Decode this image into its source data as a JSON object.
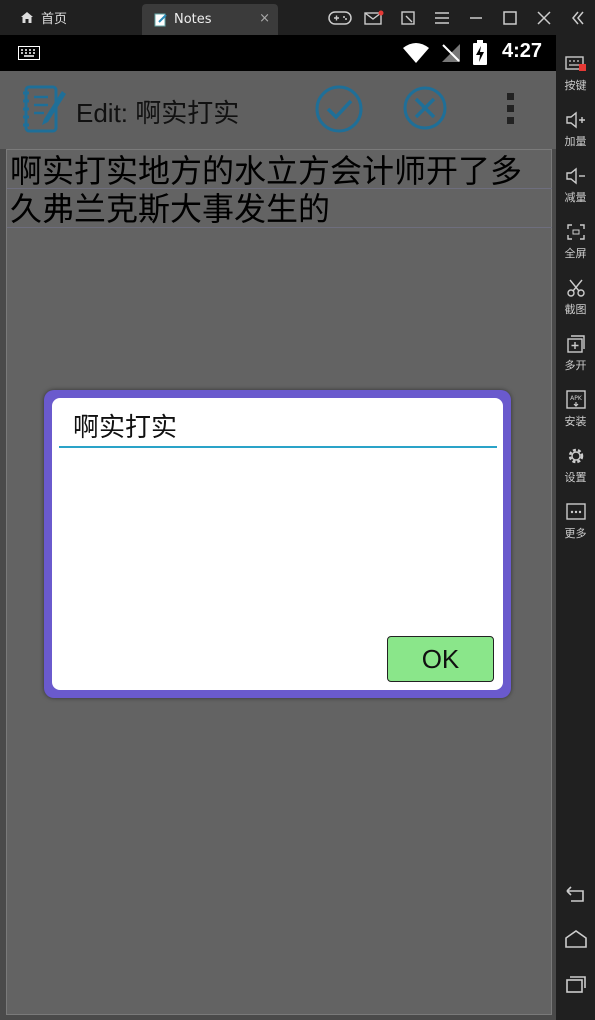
{
  "emulator": {
    "home_tab_label": "首页",
    "active_tab_label": "Notes",
    "close_glyph": "×",
    "sidebar": [
      {
        "label": "按键",
        "icon": "keyboard-icon"
      },
      {
        "label": "加量",
        "icon": "volume-up-icon"
      },
      {
        "label": "减量",
        "icon": "volume-down-icon"
      },
      {
        "label": "全屏",
        "icon": "fullscreen-icon"
      },
      {
        "label": "截图",
        "icon": "scissors-icon"
      },
      {
        "label": "多开",
        "icon": "multi-instance-icon"
      },
      {
        "label": "安装",
        "icon": "apk-icon"
      },
      {
        "label": "设置",
        "icon": "gear-icon"
      },
      {
        "label": "更多",
        "icon": "more-icon"
      }
    ]
  },
  "statusbar": {
    "time": "4:27"
  },
  "appbar": {
    "title": "Edit: 啊实打实"
  },
  "note": {
    "text": "啊实打实地方的水立方会计师开了多久弗兰克斯大事发生的"
  },
  "dialog": {
    "input_value": "啊实打实",
    "ok_label": "OK"
  },
  "colors": {
    "dialog_border": "#6a5acd",
    "ok_button": "#8ae68a",
    "input_underline": "#2aa3c8",
    "appbar_icon": "#1f6f98"
  }
}
